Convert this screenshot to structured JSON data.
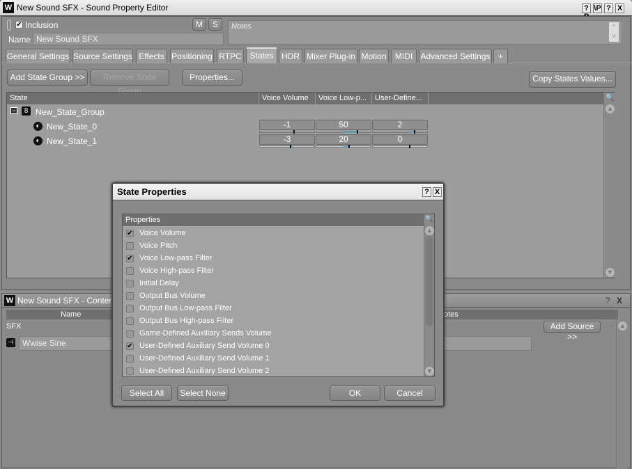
{
  "window": {
    "title": "New Sound SFX - Sound Property Editor",
    "buttons": [
      "?P",
      "\\P",
      "?",
      "X"
    ]
  },
  "top": {
    "inclusion_label": "Inclusion",
    "inclusion_checked": true,
    "mute_label": "M",
    "solo_label": "S",
    "name_label": "Name",
    "name_value": "New Sound SFX",
    "notes_placeholder": "Notes"
  },
  "tabs": [
    "General Settings",
    "Source Settings",
    "Effects",
    "Positioning",
    "RTPC",
    "States",
    "HDR",
    "Mixer Plug-in",
    "Motion",
    "MIDI",
    "Advanced Settings",
    "+"
  ],
  "active_tab": "States",
  "toolbar": {
    "add_state_group": "Add State Group >>",
    "remove_state_group": "Remove State Group",
    "properties": "Properties...",
    "copy_states": "Copy States Values..."
  },
  "states_table": {
    "columns": [
      "State",
      "Voice Volume",
      "Voice Low-p...",
      "User-Define..."
    ],
    "group": "New_State_Group",
    "rows": [
      {
        "name": "New_State_0",
        "values": [
          "-1",
          "50",
          "2"
        ]
      },
      {
        "name": "New_State_1",
        "values": [
          "-3",
          "20",
          "0"
        ]
      }
    ]
  },
  "contents": {
    "title": "New Sound SFX - Contents E",
    "col_name": "Name",
    "col_notes": "otes",
    "sfx_label": "SFX",
    "add_source": "Add Source >>",
    "source": "Wwise Sine",
    "buttons": [
      "?",
      "X"
    ]
  },
  "dialog": {
    "title": "State Properties",
    "list_header": "Properties",
    "items": [
      {
        "label": "Voice Volume",
        "checked": true
      },
      {
        "label": "Voice Pitch",
        "checked": false
      },
      {
        "label": "Voice Low-pass Filter",
        "checked": true
      },
      {
        "label": "Voice High-pass Filter",
        "checked": false
      },
      {
        "label": "Initial Delay",
        "checked": false
      },
      {
        "label": "Output Bus Volume",
        "checked": false
      },
      {
        "label": "Output Bus Low-pass Filter",
        "checked": false
      },
      {
        "label": "Output Bus High-pass Filter",
        "checked": false
      },
      {
        "label": "Game-Defined Auxiliary Sends Volume",
        "checked": false
      },
      {
        "label": "User-Defined Auxiliary Send Volume 0",
        "checked": true
      },
      {
        "label": "User-Defined Auxiliary Send Volume 1",
        "checked": false
      },
      {
        "label": "User-Defined Auxiliary Send Volume 2",
        "checked": false
      }
    ],
    "select_all": "Select All",
    "select_none": "Select None",
    "ok": "OK",
    "cancel": "Cancel",
    "help": "?",
    "close": "X"
  },
  "colors": {
    "slider_fill": "#5fa8c8",
    "panel": "#8a8a8a"
  }
}
